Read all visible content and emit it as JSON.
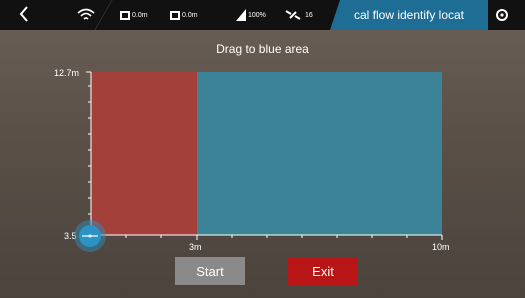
{
  "topbar": {
    "back_icon": "chevron-left-icon",
    "wifi_icon": "wifi-icon",
    "distance": "0.0m",
    "height": "0.0m",
    "battery": "100%",
    "satellites": "16",
    "title": "cal flow identify locat",
    "settings_icon": "gear-icon"
  },
  "instruction": "Drag to blue area",
  "chart": {
    "y_top_label": "12.7m",
    "y_bottom_label": "3.5",
    "x_mid_label": "3m",
    "x_end_label": "10m",
    "red_zone_color": "#a3403a",
    "blue_zone_color": "#3d8397",
    "handle_color": "#2a93c4"
  },
  "buttons": {
    "start": "Start",
    "exit": "Exit"
  }
}
